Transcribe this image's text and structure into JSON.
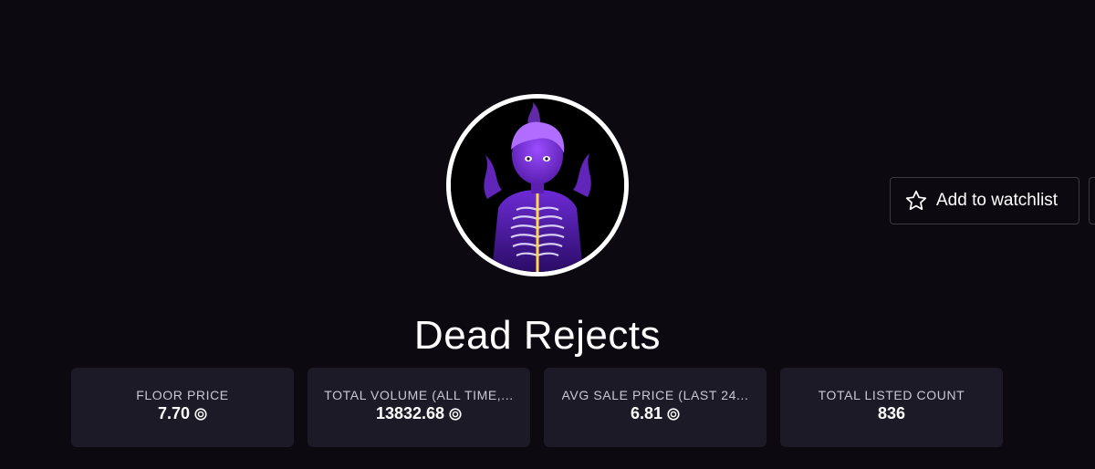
{
  "collection": {
    "name": "Dead Rejects",
    "avatar_icon": "skeleton-avatar-icon"
  },
  "actions": {
    "watchlist_label": "Add to watchlist",
    "watchlist_icon": "star-outline-icon"
  },
  "stats": [
    {
      "label": "FLOOR PRICE",
      "value": "7.70",
      "icon": "sol-currency-icon"
    },
    {
      "label": "TOTAL VOLUME (ALL TIME,...",
      "value": "13832.68",
      "icon": "sol-currency-icon"
    },
    {
      "label": "AVG SALE PRICE (LAST 24...",
      "value": "6.81",
      "icon": "sol-currency-icon"
    },
    {
      "label": "TOTAL LISTED COUNT",
      "value": "836",
      "icon": ""
    }
  ],
  "colors": {
    "background": "#0c0a10",
    "card": "#1b1a26",
    "avatar_glow": "#8a3cf0"
  }
}
